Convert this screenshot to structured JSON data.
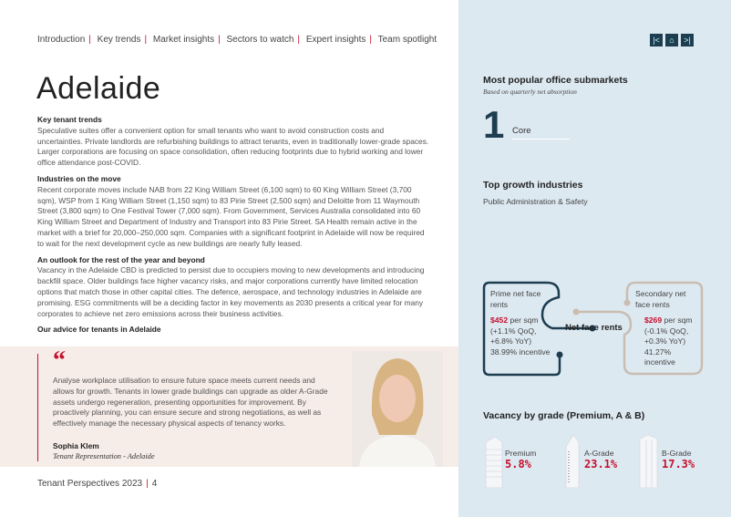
{
  "nav": {
    "items": [
      "Introduction",
      "Key trends",
      "Market insights",
      "Sectors to watch",
      "Expert insights",
      "Team spotlight"
    ]
  },
  "title": "Adelaide",
  "sections": [
    {
      "heading": "Key tenant trends",
      "text": "Speculative suites offer a convenient option for small tenants who want to avoid construction costs and uncertainties. Private landlords are refurbishing buildings to attract tenants, even in traditionally lower-grade spaces. Larger corporations are focusing on space consolidation, often reducing footprints due to hybrid working and lower office attendance post-COVID."
    },
    {
      "heading": "Industries on the move",
      "text": "Recent corporate moves include NAB from 22 King William Street (6,100 sqm) to 60 King William Street (3,700 sqm), WSP from 1 King William Street (1,150 sqm) to 83 Pirie Street (2,500 sqm) and Deloitte from 11 Waymouth Street (3,800 sqm) to  One Festival Tower (7,000 sqm). From Government, Services Australia consolidated into 60 King William Street and Department of Industry and Transport into 83 Pirie Street. SA Health remain active in the market with a brief for 20,000–250,000 sqm. Companies with a significant footprint in Adelaide will now be required to wait for the next development cycle as new buildings are nearly fully leased."
    },
    {
      "heading": "An outlook for the rest of the year and beyond",
      "text": "Vacancy in the Adelaide CBD is predicted to persist due to occupiers moving to new developments and introducing backfill space. Older buildings face higher vacancy risks, and major corporations currently have limited relocation options that match those in other capital cities. The defence, aerospace, and technology industries in Adelaide are promising. ESG commitments will be a deciding factor in key movements as 2030 presents a critical year for many corporates to achieve net zero emissions across their business activities."
    },
    {
      "heading": "Our advice for tenants in Adelaide",
      "text": ""
    }
  ],
  "quote": {
    "mark": "“",
    "text": "Analyse workplace utilisation to ensure future space meets current needs and allows for growth. Tenants in lower grade buildings can upgrade as older A-Grade assets undergo regeneration, presenting opportunities for improvement. By proactively planning, you can ensure secure and strong negotiations, as well as effectively manage the necessary physical aspects of tenancy works.",
    "name": "Sophia Klem",
    "role": "Tenant Representation - Adelaide"
  },
  "footer": {
    "publication": "Tenant Perspectives 2023",
    "page": "4"
  },
  "nav_buttons": [
    "prev-icon",
    "home-icon",
    "next-icon"
  ],
  "submarkets": {
    "title": "Most popular office submarkets",
    "subtitle": "Based on quarterly net absorption",
    "rank": "1",
    "name": "Core"
  },
  "growth": {
    "title": "Top growth industries",
    "value": "Public Administration & Safety"
  },
  "rents": {
    "center": "Net face rents",
    "prime": {
      "label": "Prime net face rents",
      "price": "$452",
      "unit": " per sqm",
      "change": "(+1.1% QoQ, +6.8% YoY)",
      "incentive": "38.99% incentive"
    },
    "secondary": {
      "label": "Secondary net face rents",
      "price": "$269",
      "unit": " per sqm",
      "change": "(-0.1% QoQ, +0.3% YoY)",
      "incentive": "41.27% incentive"
    }
  },
  "vacancy": {
    "title": "Vacancy by grade (Premium, A & B)",
    "grades": [
      {
        "label": "Premium",
        "value": "5.8%"
      },
      {
        "label": "A-Grade",
        "value": "23.1%"
      },
      {
        "label": "B-Grade",
        "value": "17.3%"
      }
    ]
  },
  "colors": {
    "accent": "#c8102e",
    "navy": "#1d3d50",
    "panel": "#dde9f1",
    "beige": "#c9bdb2"
  }
}
